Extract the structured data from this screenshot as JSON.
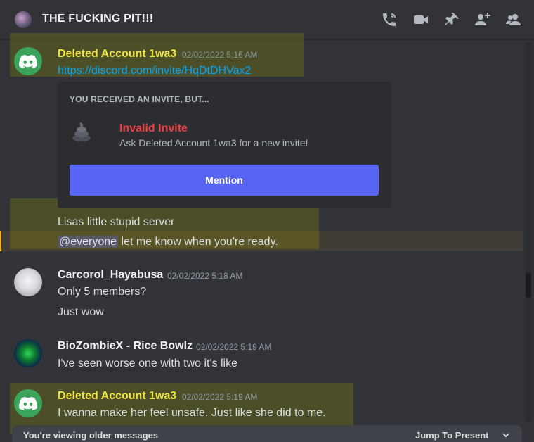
{
  "header": {
    "title": "THE FUCKING PIT!!!",
    "icons": [
      "voice-call-icon",
      "video-call-icon",
      "pin-icon",
      "add-member-icon",
      "member-list-icon"
    ]
  },
  "colors": {
    "background": "#313338",
    "discord_green": "#3ba55d",
    "link": "#00a8fc",
    "blurple": "#5865f2",
    "highlight_olive": "#80800a",
    "mention_yellow": "#f0b232",
    "deleted_name": "#f0e442",
    "error_red": "#f23f43"
  },
  "messages": [
    {
      "author": "Deleted Account 1wa3",
      "timestamp": "02/02/2022 5:16 AM",
      "link": "https://discord.com/invite/HqDtDHVax2",
      "invite": {
        "heading": "YOU RECEIVED AN INVITE, BUT...",
        "title": "Invalid Invite",
        "subtitle": "Ask Deleted Account 1wa3 for a new invite!",
        "button": "Mention"
      },
      "followups": [
        "Lisas little stupid server"
      ],
      "mention": {
        "tag": "@everyone",
        "text": " let me know when you're ready."
      }
    },
    {
      "author": "Carcorol_Hayabusa",
      "timestamp": "02/02/2022 5:18 AM",
      "lines": [
        "Only 5 members?",
        "Just wow"
      ]
    },
    {
      "author": "BioZombieX - Rice Bowlz",
      "timestamp": "02/02/2022 5:19 AM",
      "lines": [
        "I've seen worse  one with two it's like"
      ]
    },
    {
      "author": "Deleted Account 1wa3",
      "timestamp": "02/02/2022 5:19 AM",
      "lines": [
        "I wanna make her feel unsafe. Just like she did to me."
      ]
    }
  ],
  "older_bar": {
    "text": "You're viewing older messages",
    "jump": "Jump To Present"
  }
}
